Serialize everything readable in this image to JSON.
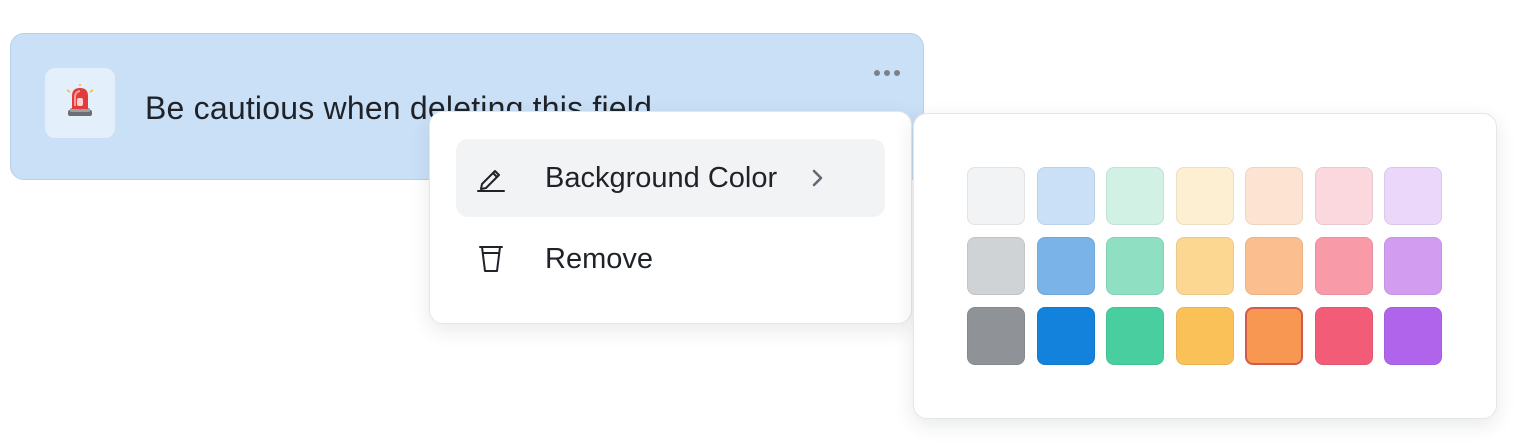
{
  "callout": {
    "icon": "police-light-icon",
    "text": "Be cautious when deleting this field",
    "background": "#cae0f6",
    "more_icon": "more-horizontal-icon"
  },
  "menu": {
    "items": [
      {
        "label": "Background Color",
        "icon": "highlighter-icon",
        "has_submenu": true,
        "active": true
      },
      {
        "label": "Remove",
        "icon": "trash-icon",
        "has_submenu": false,
        "active": false
      }
    ]
  },
  "palette": {
    "selected": {
      "row": 2,
      "col": 4
    },
    "rows": [
      [
        "#f2f3f5",
        "#cae0f6",
        "#d2f1e5",
        "#fdefd2",
        "#fde4d2",
        "#fbd7de",
        "#ead7fa"
      ],
      [
        "#d0d3d6",
        "#7ab3e8",
        "#8fe0c3",
        "#fbd792",
        "#fbbf8f",
        "#f99aa9",
        "#d29cf0"
      ],
      [
        "#8f9296",
        "#1282dc",
        "#49cea0",
        "#fbc159",
        "#f79751",
        "#f25c77",
        "#b064ec"
      ]
    ]
  }
}
